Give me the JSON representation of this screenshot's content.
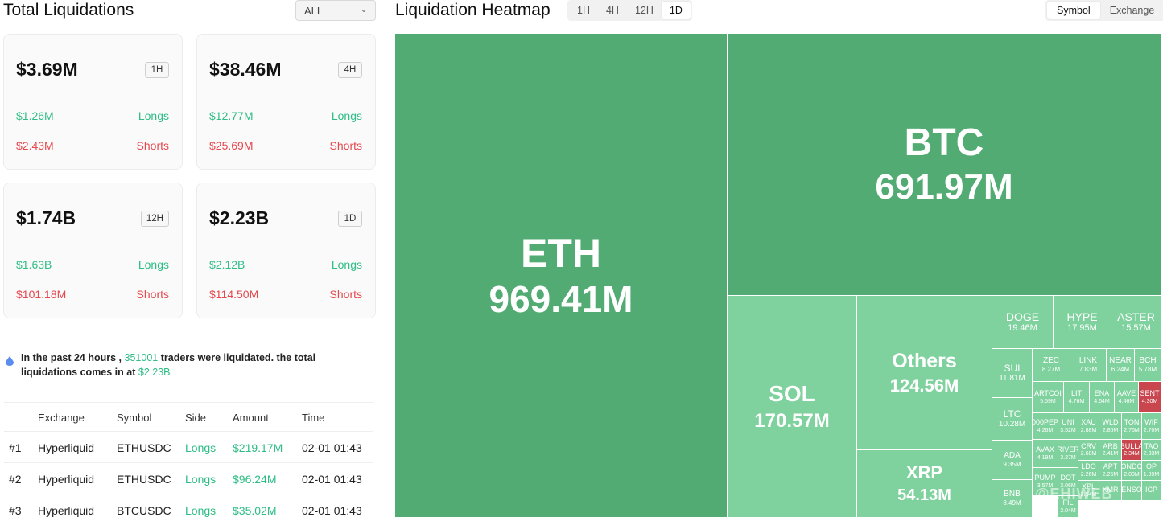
{
  "left": {
    "title": "Total Liquidations",
    "filter": {
      "value": "ALL"
    },
    "cards": [
      {
        "total": "$3.69M",
        "period": "1H",
        "long_value": "$1.26M",
        "long_label": "Longs",
        "short_value": "$2.43M",
        "short_label": "Shorts"
      },
      {
        "total": "$38.46M",
        "period": "4H",
        "long_value": "$12.77M",
        "long_label": "Longs",
        "short_value": "$25.69M",
        "short_label": "Shorts"
      },
      {
        "total": "$1.74B",
        "period": "12H",
        "long_value": "$1.63B",
        "long_label": "Longs",
        "short_value": "$101.18M",
        "short_label": "Shorts"
      },
      {
        "total": "$2.23B",
        "period": "1D",
        "long_value": "$2.12B",
        "long_label": "Longs",
        "short_value": "$114.50M",
        "short_label": "Shorts"
      }
    ],
    "info": {
      "pre": "In the past 24 hours ,",
      "traders": "351001",
      "mid": "traders were liquidated. the total liquidations comes in at",
      "total": "$2.23B"
    },
    "table": {
      "headers": [
        "Exchange",
        "Symbol",
        "Side",
        "Amount",
        "Time"
      ],
      "rows": [
        {
          "rank": "#1",
          "exchange": "Hyperliquid",
          "symbol": "ETHUSDC",
          "side": "Longs",
          "amount": "$219.17M",
          "time": "02-01 01:43"
        },
        {
          "rank": "#2",
          "exchange": "Hyperliquid",
          "symbol": "ETHUSDC",
          "side": "Longs",
          "amount": "$96.24M",
          "time": "02-01 01:43"
        },
        {
          "rank": "#3",
          "exchange": "Hyperliquid",
          "symbol": "BTCUSDC",
          "side": "Longs",
          "amount": "$35.02M",
          "time": "02-01 01:43"
        }
      ]
    }
  },
  "heatmap": {
    "title": "Liquidation Heatmap",
    "periods": [
      "1H",
      "4H",
      "12H",
      "1D"
    ],
    "active_period": "1D",
    "groupings": [
      "Symbol",
      "Exchange"
    ],
    "active_grouping": "Symbol",
    "watermark": "@EHIWEB",
    "colors": {
      "long_dark": "#52ab73",
      "long_light": "#7fd29e",
      "short": "#c9464f"
    },
    "tiles": [
      {
        "symbol": "ETH",
        "value": "969.41M",
        "side": "long"
      },
      {
        "symbol": "BTC",
        "value": "691.97M",
        "side": "long"
      },
      {
        "symbol": "SOL",
        "value": "170.57M",
        "side": "long"
      },
      {
        "symbol": "Others",
        "value": "124.56M",
        "side": "long"
      },
      {
        "symbol": "XRP",
        "value": "54.13M",
        "side": "long"
      },
      {
        "symbol": "DOGE",
        "value": "19.46M",
        "side": "long"
      },
      {
        "symbol": "HYPE",
        "value": "17.95M",
        "side": "long"
      },
      {
        "symbol": "ASTER",
        "value": "15.57M",
        "side": "long"
      },
      {
        "symbol": "SUI",
        "value": "11.81M",
        "side": "long"
      },
      {
        "symbol": "ZEC",
        "value": "8.27M",
        "side": "long"
      },
      {
        "symbol": "LINK",
        "value": "7.83M",
        "side": "long"
      },
      {
        "symbol": "NEAR",
        "value": "6.24M",
        "side": "long"
      },
      {
        "symbol": "BCH",
        "value": "5.78M",
        "side": "long"
      },
      {
        "symbol": "LTC",
        "value": "10.28M",
        "side": "long"
      },
      {
        "symbol": "ARTCOI",
        "value": "5.59M",
        "side": "long"
      },
      {
        "symbol": "LIT",
        "value": "4.76M",
        "side": "long"
      },
      {
        "symbol": "ENA",
        "value": "4.64M",
        "side": "long"
      },
      {
        "symbol": "AAVE",
        "value": "4.46M",
        "side": "long"
      },
      {
        "symbol": "SENT",
        "value": "4.30M",
        "side": "short"
      },
      {
        "symbol": "000PEP",
        "value": "4.26M",
        "side": "long"
      },
      {
        "symbol": "UNI",
        "value": "3.52M",
        "side": "long"
      },
      {
        "symbol": "XAU",
        "value": "2.88M",
        "side": "long"
      },
      {
        "symbol": "WLD",
        "value": "2.86M",
        "side": "long"
      },
      {
        "symbol": "TON",
        "value": "2.76M",
        "side": "long"
      },
      {
        "symbol": "WIF",
        "value": "2.70M",
        "side": "long"
      },
      {
        "symbol": "ADA",
        "value": "9.35M",
        "side": "long"
      },
      {
        "symbol": "AVAX",
        "value": "4.19M",
        "side": "long"
      },
      {
        "symbol": "RIVER",
        "value": "3.27M",
        "side": "long"
      },
      {
        "symbol": "CRV",
        "value": "2.68M",
        "side": "long"
      },
      {
        "symbol": "ARB",
        "value": "2.41M",
        "side": "long"
      },
      {
        "symbol": "BULLA",
        "value": "2.34M",
        "side": "short"
      },
      {
        "symbol": "TAO",
        "value": "2.33M",
        "side": "long"
      },
      {
        "symbol": "LDO",
        "value": "2.26M",
        "side": "long"
      },
      {
        "symbol": "APT",
        "value": "2.26M",
        "side": "long"
      },
      {
        "symbol": "ONDO",
        "value": "2.00M",
        "side": "long"
      },
      {
        "symbol": "OP",
        "value": "1.99M",
        "side": "long"
      },
      {
        "symbol": "PUMP",
        "value": "3.57M",
        "side": "long"
      },
      {
        "symbol": "DOT",
        "value": "3.06M",
        "side": "long"
      },
      {
        "symbol": "XPL",
        "value": "2.54M",
        "side": "long"
      },
      {
        "symbol": "XMR",
        "value": "",
        "side": "long"
      },
      {
        "symbol": "ENSO",
        "value": "",
        "side": "long"
      },
      {
        "symbol": "ICP",
        "value": "",
        "side": "long"
      },
      {
        "symbol": "BNB",
        "value": "8.49M",
        "side": "long"
      },
      {
        "symbol": "FIL",
        "value": "3.04M",
        "side": "long"
      }
    ]
  }
}
